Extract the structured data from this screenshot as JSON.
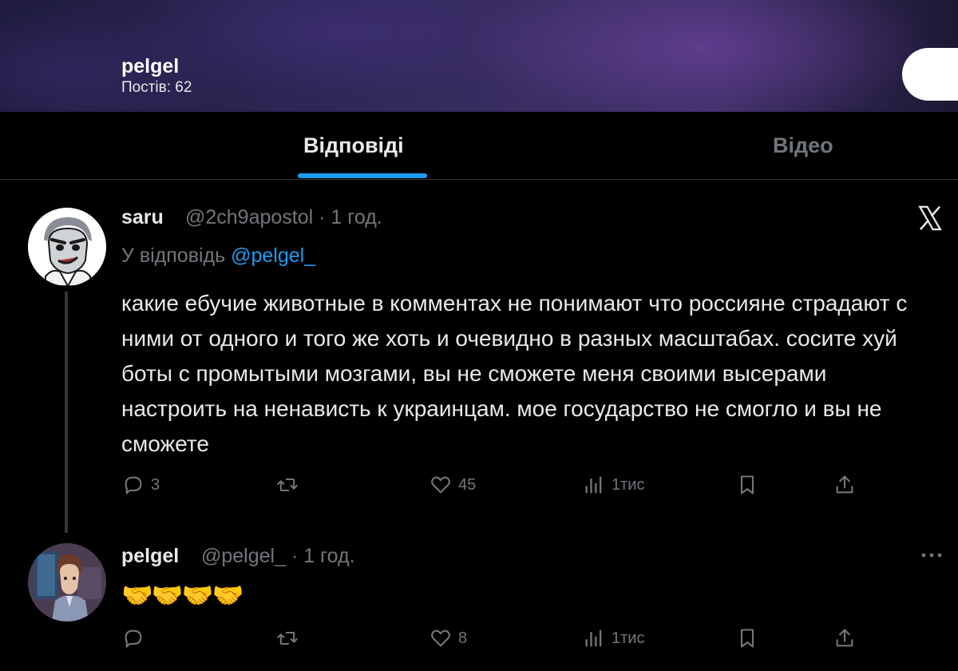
{
  "header": {
    "title": "pelgel",
    "posts_count": "Постів: 62"
  },
  "tabs": [
    {
      "label": "Відповіді",
      "active": true
    },
    {
      "label": "Відео",
      "active": false
    }
  ],
  "tweets": [
    {
      "name": "saru",
      "handle": "@2ch9apostol · 1 год.",
      "reply_prefix": "У відповідь",
      "reply_mention": "@pelgel_",
      "text": "какие ебучие животные в комментах не понимают что россияне страдают с ними от одного и того же хоть и очевидно в разных масштабах. сосите хуй боты с промытыми мозгами, вы не сможете меня своими высерами настроить на ненависть к украинцам. мое государство не смогло и вы не сможете",
      "replies": "3",
      "likes": "45",
      "views": "1тис",
      "badge_icon": "x-logo-icon"
    },
    {
      "name": "pelgel",
      "handle": "@pelgel_ · 1 год.",
      "text": "🤝🤝🤝🤝",
      "replies": "",
      "likes": "8",
      "views": "1тис",
      "menu_icon": "more-options-icon"
    }
  ],
  "colors": {
    "accent": "#1d9bf0",
    "text": "#e7e9ea",
    "muted": "#71767b",
    "background": "#000000"
  }
}
